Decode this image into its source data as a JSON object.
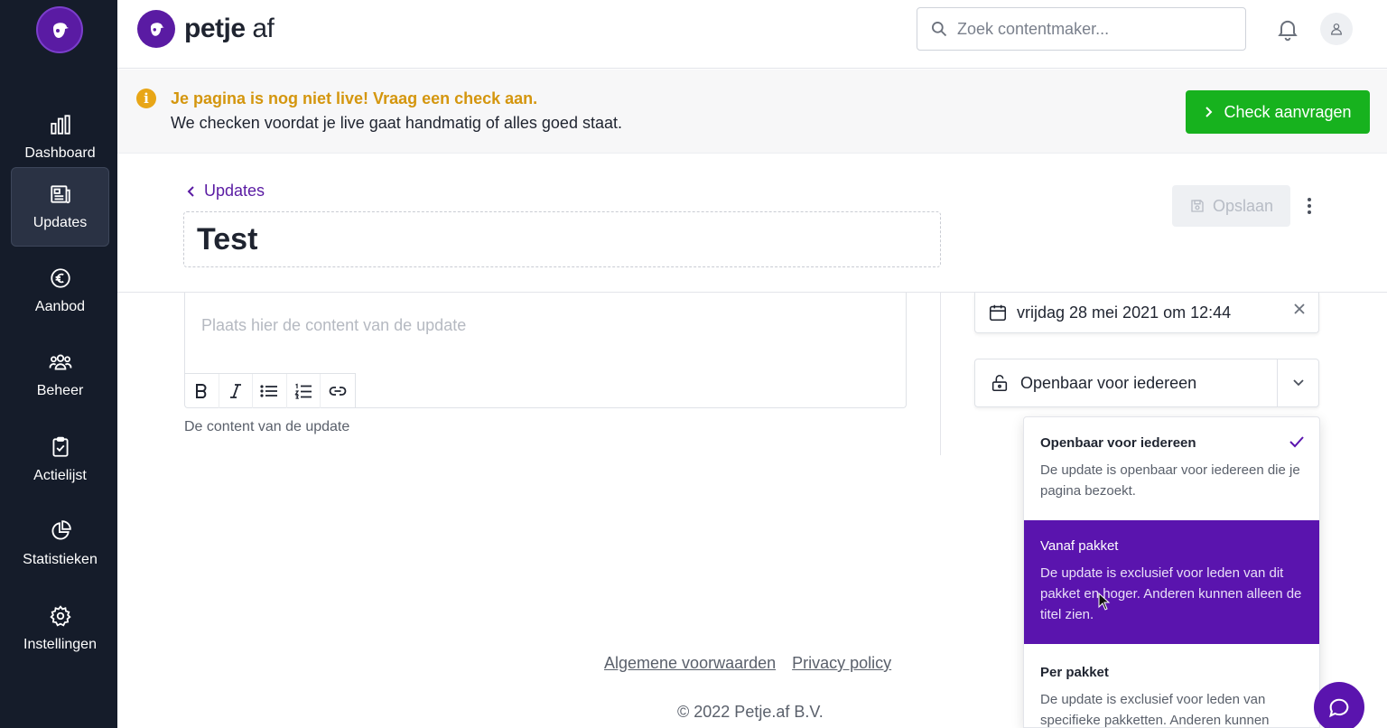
{
  "brand": {
    "name_bold": "petje",
    "name_light": " af"
  },
  "search": {
    "placeholder": "Zoek contentmaker..."
  },
  "sidebar": {
    "items": [
      {
        "label": "Dashboard",
        "icon": "bar-chart-icon"
      },
      {
        "label": "Updates",
        "icon": "newspaper-icon",
        "active": true
      },
      {
        "label": "Aanbod",
        "icon": "euro-icon"
      },
      {
        "label": "Beheer",
        "icon": "users-icon"
      },
      {
        "label": "Actielijst",
        "icon": "clipboard-check-icon"
      },
      {
        "label": "Statistieken",
        "icon": "pie-chart-icon"
      },
      {
        "label": "Instellingen",
        "icon": "gear-icon"
      }
    ]
  },
  "banner": {
    "title": "Je pagina is nog niet live! Vraag een check aan.",
    "text": "We checken voordat je live gaat handmatig of alles goed staat.",
    "button": "Check aanvragen"
  },
  "editor": {
    "back_label": "Updates",
    "title": "Test",
    "save_label": "Opslaan",
    "content_placeholder": "Plaats hier de content van de update",
    "helper": "De content van de update"
  },
  "settings": {
    "date": "vrijdag 28 mei 2021 om 12:44",
    "visibility": "Openbaar voor iedereen"
  },
  "dropdown": {
    "options": [
      {
        "title": "Openbaar voor iedereen",
        "desc": "De update is openbaar voor iedereen die je pagina bezoekt.",
        "checked": true
      },
      {
        "title": "Vanaf pakket",
        "desc": "De update is exclusief voor leden van dit pakket en hoger. Anderen kunnen alleen de titel zien.",
        "highlighted": true
      },
      {
        "title": "Per pakket",
        "desc": "De update is exclusief voor leden van specifieke pakketten. Anderen kunnen"
      }
    ]
  },
  "footer": {
    "terms": "Algemene voorwaarden",
    "privacy": "Privacy policy",
    "copyright": "© 2022 Petje.af B.V."
  },
  "colors": {
    "brand": "#5a14ae",
    "success": "#17b21e",
    "warning": "#d4960e",
    "sidebar": "#151c2a"
  }
}
